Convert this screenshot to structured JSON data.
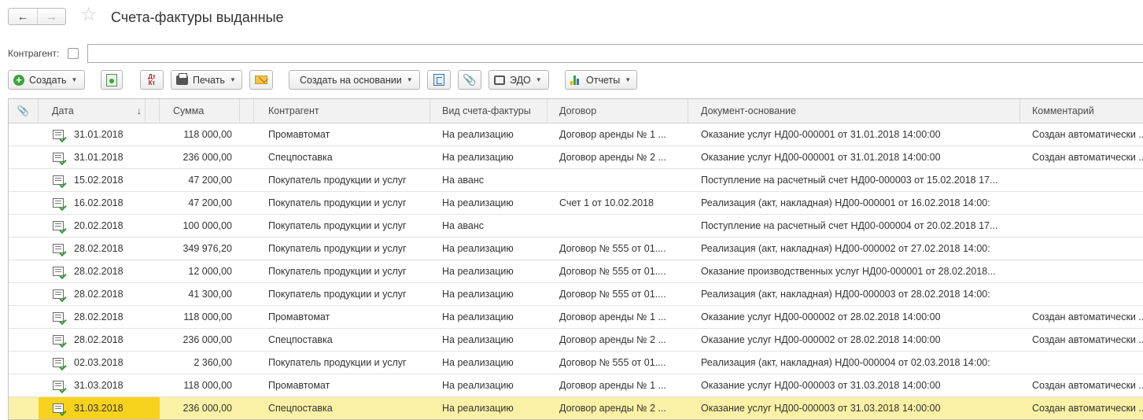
{
  "window": {
    "title": "Счета-фактуры выданные",
    "nav_back": "←",
    "nav_forward": "→",
    "favorite_icon": "☆"
  },
  "filter": {
    "label": "Контрагент:",
    "value": ""
  },
  "toolbar": {
    "create_label": "Создать",
    "print_label": "Печать",
    "create_based_label": "Создать на основании",
    "edo_label": "ЭДО",
    "reports_label": "Отчеты",
    "dtkt_label": "Дт\nКт",
    "clip_icon": "📎",
    "dropdown_arrow": "▼"
  },
  "colors": {
    "selected_row": "#fbf1a6",
    "selected_cell": "#f7d21c",
    "create_icon": "#3aa53a"
  },
  "table": {
    "columns": {
      "clip": "📎",
      "date": "Дата",
      "sort_arrow": "↓",
      "sum": "Сумма",
      "kontr": "Контрагент",
      "vid": "Вид счета-фактуры",
      "dog": "Договор",
      "doc": "Документ-основание",
      "comm": "Комментарий"
    },
    "rows": [
      {
        "date": "31.01.2018",
        "sum": "118 000,00",
        "kontr": "Промавтомат",
        "vid": "На реализацию",
        "dog": "Договор аренды № 1 ...",
        "doc": "Оказание услуг НД00-000001 от 31.01.2018 14:00:00",
        "comm": "Создан автоматически ..."
      },
      {
        "date": "31.01.2018",
        "sum": "236 000,00",
        "kontr": "Спецпоставка",
        "vid": "На реализацию",
        "dog": "Договор аренды № 2 ...",
        "doc": "Оказание услуг НД00-000001 от 31.01.2018 14:00:00",
        "comm": "Создан автоматически ..."
      },
      {
        "date": "15.02.2018",
        "sum": "47 200,00",
        "kontr": "Покупатель продукции и услуг",
        "vid": "На аванс",
        "dog": "",
        "doc": "Поступление на расчетный счет НД00-000003 от 15.02.2018 17...",
        "comm": ""
      },
      {
        "date": "16.02.2018",
        "sum": "47 200,00",
        "kontr": "Покупатель продукции и услуг",
        "vid": "На реализацию",
        "dog": "Счет 1 от 10.02.2018",
        "doc": "Реализация (акт, накладная) НД00-000001 от 16.02.2018 14:00:",
        "comm": ""
      },
      {
        "date": "20.02.2018",
        "sum": "100 000,00",
        "kontr": "Покупатель продукции и услуг",
        "vid": "На аванс",
        "dog": "",
        "doc": "Поступление на расчетный счет НД00-000004 от 20.02.2018 17...",
        "comm": ""
      },
      {
        "date": "28.02.2018",
        "sum": "349 976,20",
        "kontr": "Покупатель продукции и услуг",
        "vid": "На реализацию",
        "dog": "Договор № 555 от 01....",
        "doc": "Реализация (акт, накладная) НД00-000002 от 27.02.2018 14:00:",
        "comm": ""
      },
      {
        "date": "28.02.2018",
        "sum": "12 000,00",
        "kontr": "Покупатель продукции и услуг",
        "vid": "На реализацию",
        "dog": "Договор № 555 от 01....",
        "doc": "Оказание производственных услуг НД00-000001 от 28.02.2018...",
        "comm": ""
      },
      {
        "date": "28.02.2018",
        "sum": "41 300,00",
        "kontr": "Покупатель продукции и услуг",
        "vid": "На реализацию",
        "dog": "Договор № 555 от 01....",
        "doc": "Реализация (акт, накладная) НД00-000003 от 28.02.2018 14:00:",
        "comm": ""
      },
      {
        "date": "28.02.2018",
        "sum": "118 000,00",
        "kontr": "Промавтомат",
        "vid": "На реализацию",
        "dog": "Договор аренды № 1 ...",
        "doc": "Оказание услуг НД00-000002 от 28.02.2018 14:00:00",
        "comm": "Создан автоматически ..."
      },
      {
        "date": "28.02.2018",
        "sum": "236 000,00",
        "kontr": "Спецпоставка",
        "vid": "На реализацию",
        "dog": "Договор аренды № 2 ...",
        "doc": "Оказание услуг НД00-000002 от 28.02.2018 14:00:00",
        "comm": "Создан автоматически ..."
      },
      {
        "date": "02.03.2018",
        "sum": "2 360,00",
        "kontr": "Покупатель продукции и услуг",
        "vid": "На реализацию",
        "dog": "Договор № 555 от 01....",
        "doc": "Реализация (акт, накладная) НД00-000004 от 02.03.2018 14:00:",
        "comm": ""
      },
      {
        "date": "31.03.2018",
        "sum": "118 000,00",
        "kontr": "Промавтомат",
        "vid": "На реализацию",
        "dog": "Договор аренды № 1 ...",
        "doc": "Оказание услуг НД00-000003 от 31.03.2018 14:00:00",
        "comm": "Создан автоматически ..."
      },
      {
        "date": "31.03.2018",
        "sum": "236 000,00",
        "kontr": "Спецпоставка",
        "vid": "На реализацию",
        "dog": "Договор аренды № 2 ...",
        "doc": "Оказание услуг НД00-000003 от 31.03.2018 14:00:00",
        "comm": "Создан автоматически ...",
        "selected": true
      }
    ]
  }
}
